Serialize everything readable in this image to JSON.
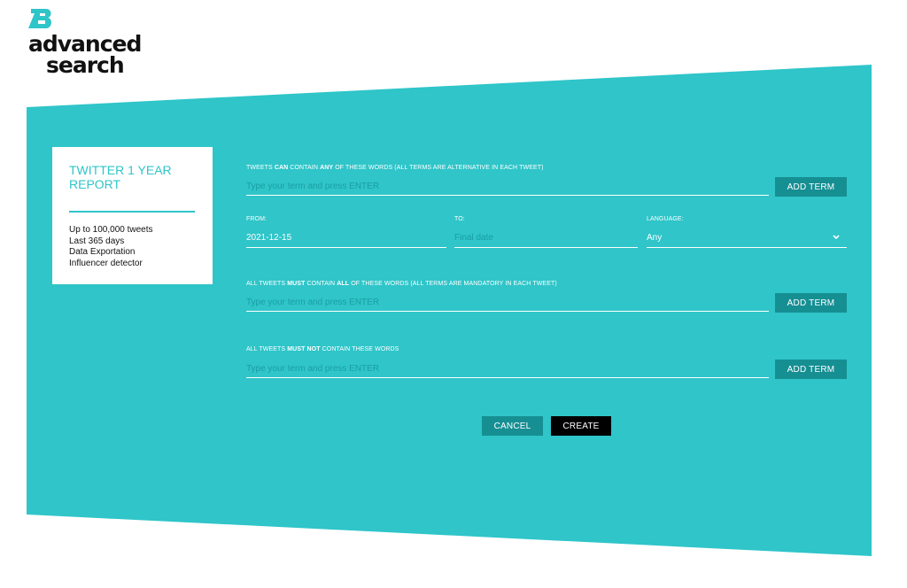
{
  "logo": {
    "line1": "advanced",
    "line2": "search",
    "mark_icon": "tb-logo-icon"
  },
  "colors": {
    "teal": "#2fc5c9",
    "dark_teal": "#168f93",
    "placeholder": "#1a9ea3"
  },
  "plan": {
    "title": "TWITTER 1 YEAR REPORT",
    "features": [
      "Up to 100,000 tweets",
      "Last 365 days",
      "Data Exportation",
      "Influencer detector"
    ]
  },
  "form": {
    "any_words": {
      "label_pre": "TWEETS ",
      "label_b1": "CAN",
      "label_mid": " CONTAIN ",
      "label_b2": "ANY",
      "label_post": " OF THESE WORDS (ALL TERMS ARE ALTERNATIVE IN EACH TWEET)",
      "placeholder": "Type your term and press ENTER",
      "button": "ADD TERM"
    },
    "from": {
      "label": "FROM:",
      "value": "2021-12-15"
    },
    "to": {
      "label": "TO:",
      "placeholder": "Final date"
    },
    "language": {
      "label": "LANGUAGE:",
      "value": "Any",
      "icon": "chevron-down-icon"
    },
    "all_words": {
      "label_pre": "ALL TWEETS ",
      "label_b1": "MUST",
      "label_mid": " CONTAIN ",
      "label_b2": "ALL",
      "label_post": " OF THESE WORDS (ALL TERMS ARE MANDATORY IN EACH TWEET)",
      "placeholder": "Type your term and press ENTER",
      "button": "ADD TERM"
    },
    "not_words": {
      "label_pre": "ALL TWEETS ",
      "label_b1": "MUST NOT",
      "label_post": " CONTAIN THESE WORDS",
      "placeholder": "Type your term and press ENTER",
      "button": "ADD TERM"
    },
    "cancel_label": "CANCEL",
    "create_label": "CREATE"
  }
}
